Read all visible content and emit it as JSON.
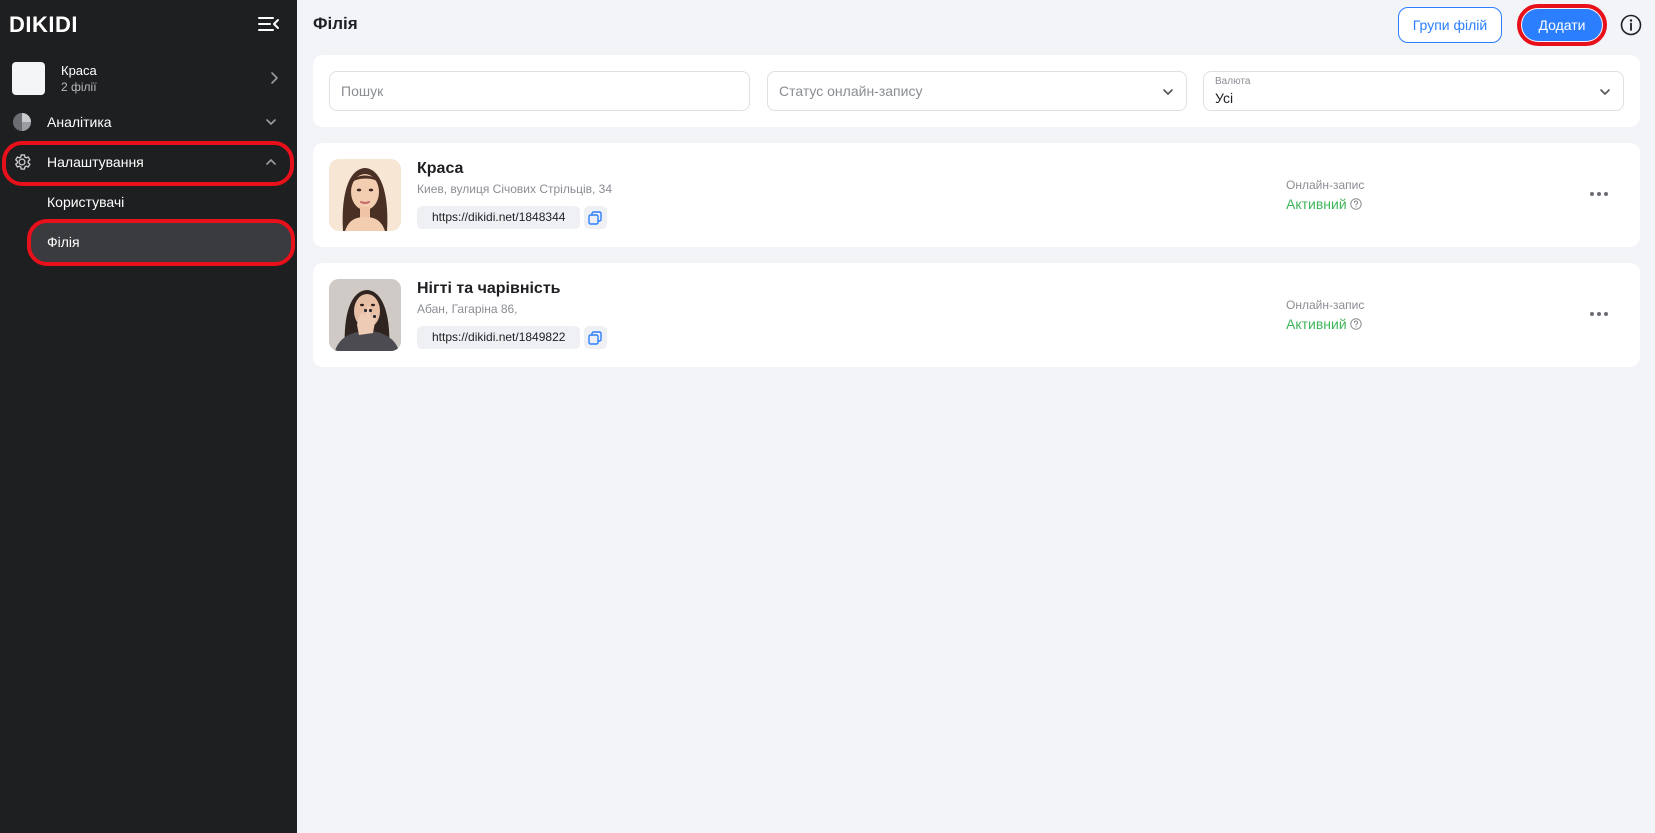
{
  "sidebar": {
    "logo": "DIKIDI",
    "org": {
      "name": "Краса",
      "subtitle": "2 філії"
    },
    "nav": [
      {
        "label": "Аналітика",
        "icon": "pie-chart-icon",
        "expanded": false
      },
      {
        "label": "Налаштування",
        "icon": "gear-icon",
        "expanded": true,
        "children": [
          {
            "label": "Користувачі",
            "active": false
          },
          {
            "label": "Філія",
            "active": true
          }
        ]
      }
    ]
  },
  "header": {
    "title": "Філія",
    "groups_button": "Групи філій",
    "add_button": "Додати",
    "info_icon": "info-icon"
  },
  "filters": {
    "search_placeholder": "Пошук",
    "status_placeholder": "Статус онлайн-запису",
    "currency_caption": "Валюта",
    "currency_value": "Усі"
  },
  "branches": [
    {
      "name": "Краса",
      "address": "Киев, вулиця Січових Стрільців, 34",
      "link": "https://dikidi.net/1848344",
      "online_label": "Онлайн-запис",
      "online_status": "Активний"
    },
    {
      "name": "Нігті та чарівність",
      "address": "Абан, Гагаріна 86,",
      "link": "https://dikidi.net/1849822",
      "online_label": "Онлайн-запис",
      "online_status": "Активний"
    }
  ],
  "colors": {
    "sidebar_bg": "#1e1f21",
    "accent": "#2b7fff",
    "active_status": "#3fb55b",
    "highlight": "#e8101a"
  }
}
